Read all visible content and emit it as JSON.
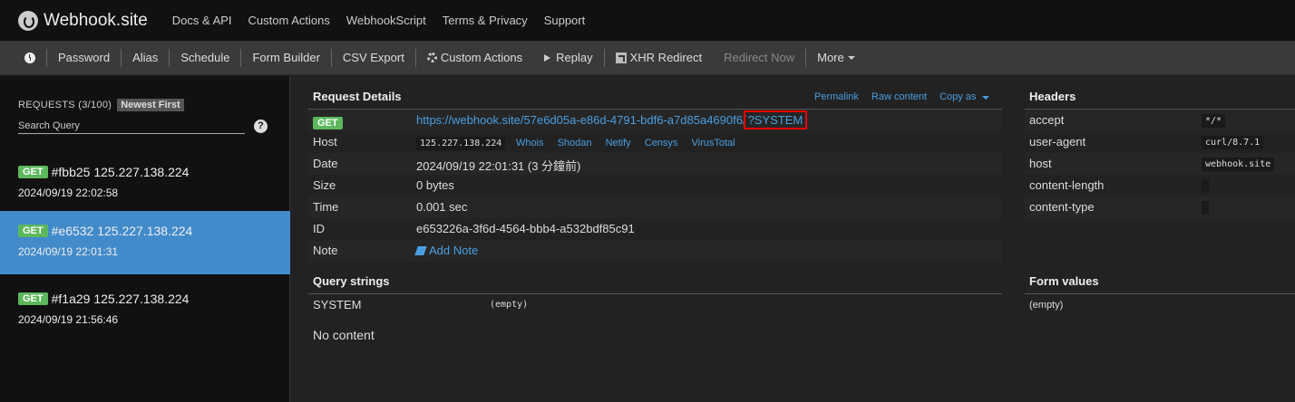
{
  "brand": {
    "title": "Webhook.site"
  },
  "topnav": [
    "Docs & API",
    "Custom Actions",
    "WebhookScript",
    "Terms & Privacy",
    "Support"
  ],
  "toolbar": {
    "password": "Password",
    "alias": "Alias",
    "schedule": "Schedule",
    "form_builder": "Form Builder",
    "csv_export": "CSV Export",
    "custom_actions": "Custom Actions",
    "replay": "Replay",
    "xhr_redirect": "XHR Redirect",
    "redirect_now": "Redirect Now",
    "more": "More"
  },
  "sidebar": {
    "title": "REQUESTS (3/100)",
    "sort": "Newest First",
    "search_placeholder": "Search Query",
    "help": "?",
    "requests": [
      {
        "method": "GET",
        "label": "#fbb25 125.227.138.224",
        "time": "2024/09/19 22:02:58",
        "active": false
      },
      {
        "method": "GET",
        "label": "#e6532 125.227.138.224",
        "time": "2024/09/19 22:01:31",
        "active": true
      },
      {
        "method": "GET",
        "label": "#f1a29 125.227.138.224",
        "time": "2024/09/19 21:56:46",
        "active": false
      }
    ]
  },
  "details": {
    "title": "Request Details",
    "links": {
      "permalink": "Permalink",
      "raw": "Raw content",
      "copy_as": "Copy as"
    },
    "method": "GET",
    "url_base": "https://webhook.site/57e6d05a-e86d-4791-bdf6-a7d85a4690f6/",
    "url_query": "?SYSTEM",
    "host_label": "Host",
    "host_ip": "125.227.138.224",
    "host_links": [
      "Whois",
      "Shodan",
      "Netify",
      "Censys",
      "VirusTotal"
    ],
    "date_label": "Date",
    "date_value": "2024/09/19 22:01:31 (3 分鐘前)",
    "size_label": "Size",
    "size_value": "0 bytes",
    "time_label": "Time",
    "time_value": "0.001 sec",
    "id_label": "ID",
    "id_value": "e653226a-3f6d-4564-bbb4-a532bdf85c91",
    "note_label": "Note",
    "note_action": "Add Note"
  },
  "headers": {
    "title": "Headers",
    "rows": [
      {
        "key": "accept",
        "value": "*/*"
      },
      {
        "key": "user-agent",
        "value": "curl/8.7.1"
      },
      {
        "key": "host",
        "value": "webhook.site"
      },
      {
        "key": "content-length",
        "value": ""
      },
      {
        "key": "content-type",
        "value": ""
      }
    ]
  },
  "query_strings": {
    "title": "Query strings",
    "key": "SYSTEM",
    "value": "(empty)"
  },
  "form_values": {
    "title": "Form values",
    "value": "(empty)"
  },
  "body": {
    "no_content": "No content"
  }
}
